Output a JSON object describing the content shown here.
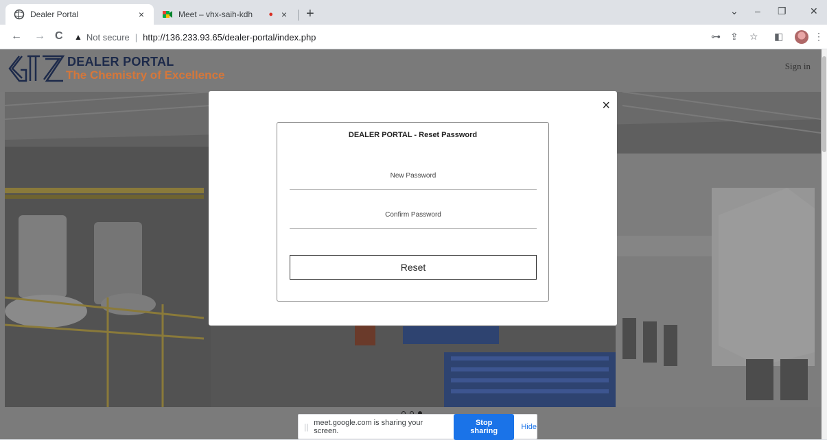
{
  "browser": {
    "tabs": [
      {
        "title": "Dealer Portal",
        "close": "×"
      },
      {
        "title": "Meet – vhx-saih-kdh",
        "close": "×",
        "recording": "●"
      }
    ],
    "new_tab": "+",
    "window_controls": {
      "minimize": "–",
      "maximize": "❐",
      "close": "✕",
      "dropdown": "⌄"
    },
    "nav": {
      "back": "←",
      "forward": "→",
      "reload": "C"
    },
    "omnibox": {
      "warning": "▲",
      "security_label": "Not secure",
      "separator": "|",
      "url": "http://136.233.93.65/dealer-portal/index.php"
    },
    "toolbar_icons": {
      "key": "⊶",
      "share": "⇪",
      "star": "☆",
      "sidepanel": "◧",
      "menu": "⋮"
    }
  },
  "site": {
    "brand_title": "DEALER PORTAL",
    "brand_tagline": "The Chemistry of Excellence",
    "logo_text": "GTZ",
    "sign_in": "Sign in"
  },
  "modal": {
    "close": "×",
    "card_title": "DEALER PORTAL - Reset Password",
    "new_password_placeholder": "New Password",
    "confirm_password_placeholder": "Confirm Password",
    "reset_label": "Reset"
  },
  "carousel": {
    "active_index": 2,
    "count": 3
  },
  "share_bar": {
    "grip": "||",
    "message": "meet.google.com is sharing your screen.",
    "stop_label": "Stop sharing",
    "hide_label": "Hide"
  },
  "colors": {
    "brand_navy": "#1d2a4a",
    "brand_orange": "#d6773a",
    "accent_blue": "#1a73e8"
  }
}
